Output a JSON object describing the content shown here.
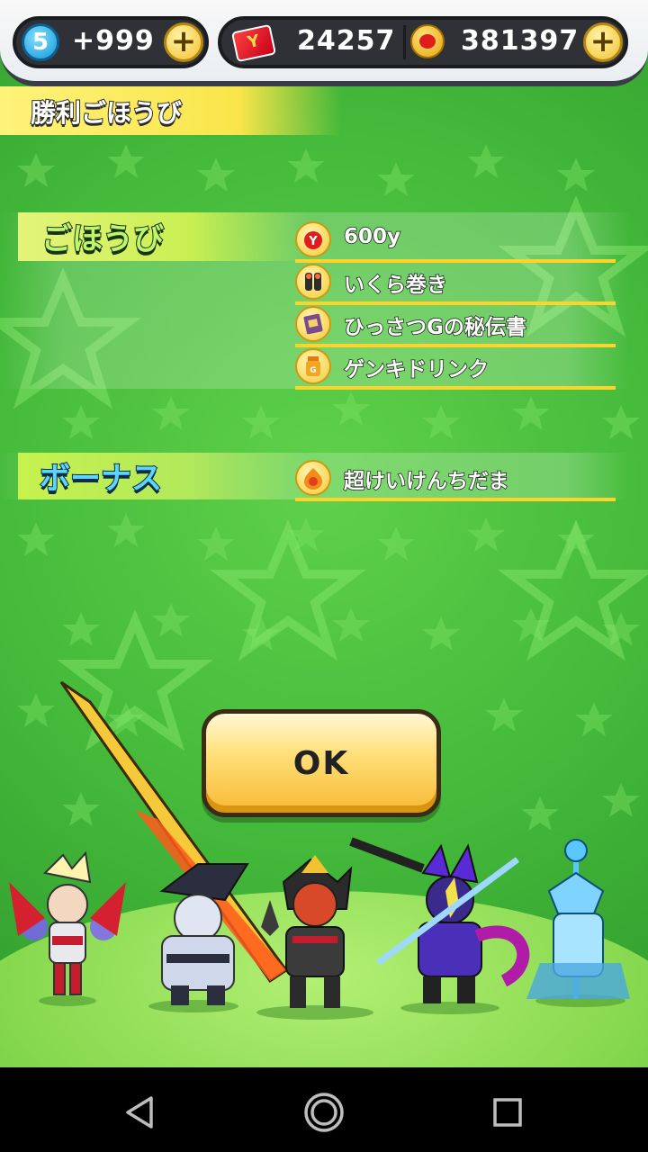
{
  "topbar": {
    "stamina_level": "5",
    "stamina_value": "+999",
    "tickets": "24257",
    "money": "381397"
  },
  "title": "勝利ごほうび",
  "rewards": {
    "label": "ごほうび",
    "items": [
      {
        "label": "600y",
        "icon": "money-bag-icon"
      },
      {
        "label": "いくら巻き",
        "icon": "sushi-icon"
      },
      {
        "label": "ひっさつGの秘伝書",
        "icon": "secret-book-icon"
      },
      {
        "label": "ゲンキドリンク",
        "icon": "drink-icon"
      }
    ]
  },
  "bonus": {
    "label": "ボーナス",
    "items": [
      {
        "label": "超けいけんちだま",
        "icon": "exp-orb-icon"
      }
    ]
  },
  "ok_label": "OK",
  "colors": {
    "background": "#43b83a",
    "accent_yellow": "#ffd42a",
    "button": "#ffe07a"
  }
}
